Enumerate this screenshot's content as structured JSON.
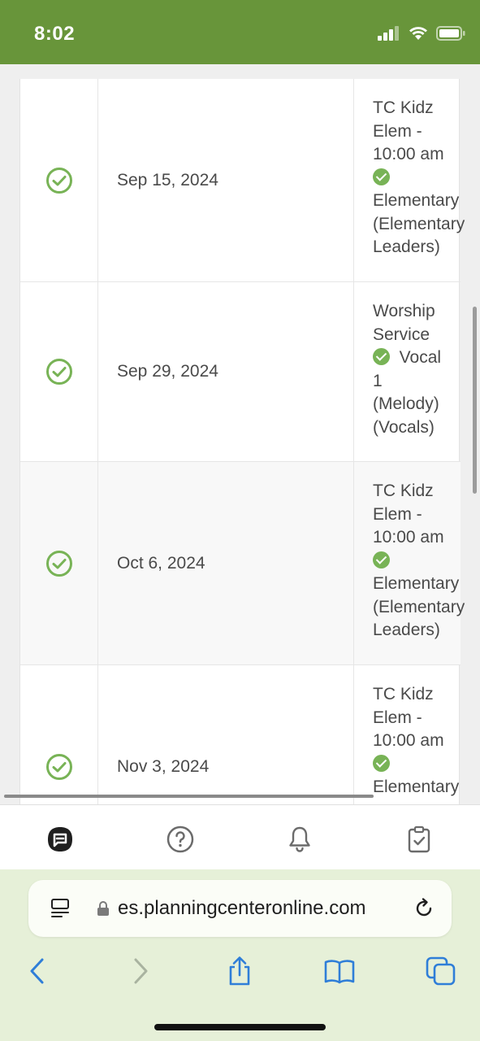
{
  "status_bar": {
    "time": "8:02"
  },
  "rows": [
    {
      "date": "Sep 15, 2024",
      "detail_top": [
        "TC Kidz",
        "Elem -",
        "10:00 am"
      ],
      "detail_role": "Elementary",
      "detail_bottom": [
        "(Elementary",
        "Leaders)"
      ]
    },
    {
      "date": "Sep 29, 2024",
      "detail_top": [
        "Worship",
        "Service"
      ],
      "detail_role": "Vocal",
      "detail_bottom": [
        "1",
        "(Melody)",
        "(Vocals)"
      ]
    },
    {
      "date": "Oct 6, 2024",
      "detail_top": [
        "TC Kidz",
        "Elem -",
        "10:00 am"
      ],
      "detail_role": "Elementary",
      "detail_bottom": [
        "(Elementary",
        "Leaders)"
      ]
    },
    {
      "date": "Nov 3, 2024",
      "detail_top": [
        "TC Kidz",
        "Elem -",
        "10:00 am"
      ],
      "detail_role": "Elementary",
      "detail_bottom": []
    }
  ],
  "app_tabs": [
    "planning-center-logo-icon",
    "help-icon",
    "bell-icon",
    "clipboard-check-icon"
  ],
  "safari": {
    "url": "es.planningcenteronline.com"
  },
  "colors": {
    "brand_green": "#68953a",
    "check_green": "#78b356",
    "safari_blue": "#2f7ed8"
  }
}
